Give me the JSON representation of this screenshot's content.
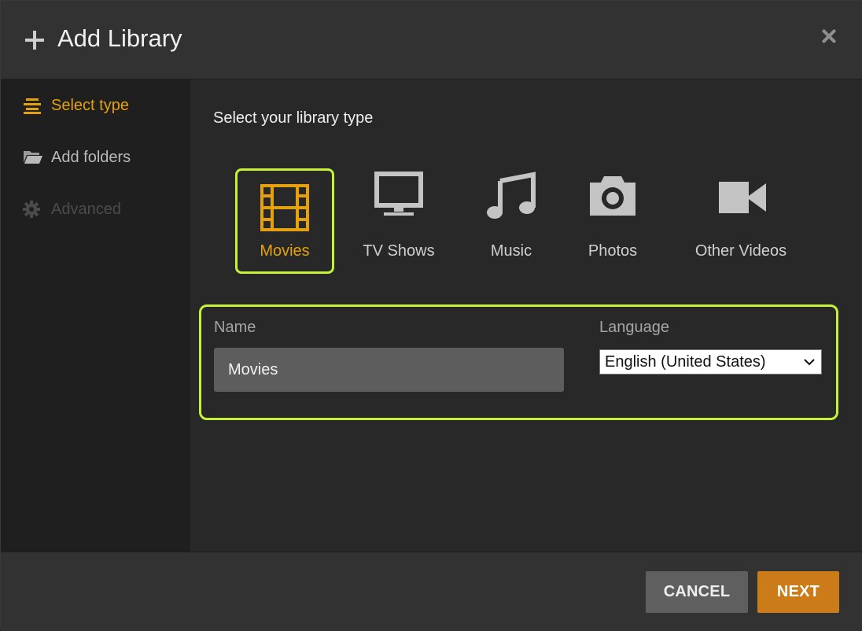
{
  "header": {
    "title": "Add Library",
    "add_icon": "plus-icon",
    "close_icon": "close-icon"
  },
  "sidebar": {
    "items": [
      {
        "label": "Select type",
        "icon": "list-icon",
        "state": "active"
      },
      {
        "label": "Add folders",
        "icon": "folder-open-icon",
        "state": "normal"
      },
      {
        "label": "Advanced",
        "icon": "gear-icon",
        "state": "disabled"
      }
    ]
  },
  "main": {
    "heading": "Select your library type",
    "types": [
      {
        "label": "Movies",
        "icon": "film-icon",
        "selected": true
      },
      {
        "label": "TV Shows",
        "icon": "tv-icon",
        "selected": false
      },
      {
        "label": "Music",
        "icon": "music-note-icon",
        "selected": false
      },
      {
        "label": "Photos",
        "icon": "camera-icon",
        "selected": false
      },
      {
        "label": "Other Videos",
        "icon": "video-camera-icon",
        "selected": false
      }
    ],
    "form": {
      "name_label": "Name",
      "name_value": "Movies",
      "language_label": "Language",
      "language_value": "English (United States)"
    }
  },
  "footer": {
    "cancel_label": "CANCEL",
    "next_label": "NEXT"
  },
  "colors": {
    "accent": "#e5a00d",
    "highlight": "#c4f238",
    "next_button": "#cc7b19",
    "cancel_button": "#5f5f5f"
  }
}
